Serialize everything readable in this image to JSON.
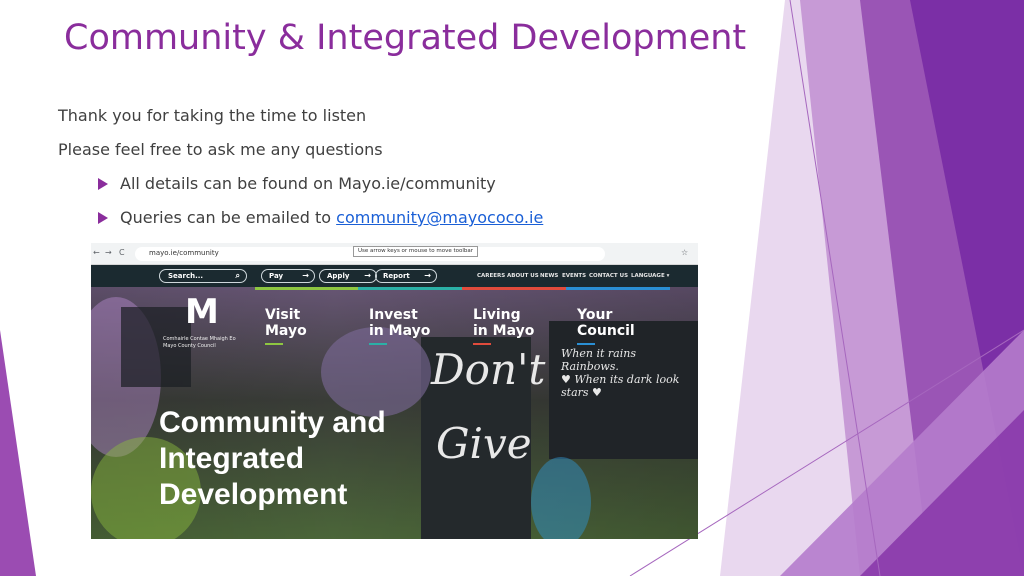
{
  "slide": {
    "title": "Community & Integrated Development",
    "lines": [
      "Thank you for taking the time to listen",
      "Please feel free to ask me any questions"
    ],
    "bullet1": "All details can be found on Mayo.ie/community",
    "bullet2_prefix": "Queries can be emailed to ",
    "bullet2_email": "community@mayococo.ie",
    "accent_color": "#8a2d9c",
    "link_color": "#1a5fd6"
  },
  "screenshot": {
    "browser": {
      "url": "mayo.ie/community",
      "tooltip": "Use arrow keys or mouse to move toolbar",
      "back_icon": "←",
      "forward_icon": "→",
      "reload_icon": "C",
      "bookmark_icon": "☆"
    },
    "site": {
      "search_placeholder": "Search...",
      "search_icon": "⌕",
      "pay_label": "Pay",
      "apply_label": "Apply",
      "report_label": "Report",
      "pill_arrow": "→",
      "nav": [
        "CAREERS",
        "ABOUT US",
        "NEWS",
        "EVENTS",
        "CONTACT US",
        "LANGUAGE ▾"
      ],
      "logo_letter": "M",
      "logo_line1": "Comhairle Contae Mhaigh Eo",
      "logo_line2": "Mayo County Council",
      "sections": [
        {
          "line1": "Visit",
          "line2": "Mayo",
          "color": "#8ec641"
        },
        {
          "line1": "Invest",
          "line2": "in Mayo",
          "color": "#2bb0a6"
        },
        {
          "line1": "Living",
          "line2": "in Mayo",
          "color": "#e04b3c"
        },
        {
          "line1": "Your",
          "line2": "Council",
          "color": "#2a8fd4"
        }
      ],
      "hero_line1": "Community and",
      "hero_line2": "Integrated",
      "hero_line3": "Development"
    }
  }
}
